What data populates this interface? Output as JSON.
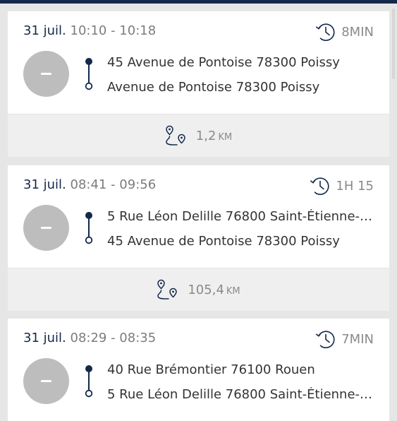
{
  "colors": {
    "header_bar": "#14284a",
    "date_text": "#14284a",
    "muted_text": "#7c7c7c",
    "status_circle": "#bdbdbd"
  },
  "trips": [
    {
      "date": "31 juil.",
      "time_range": "10:10 - 10:18",
      "duration": "8MIN",
      "status_icon": "dash-icon",
      "from": "45 Avenue de Pontoise 78300 Poissy",
      "to": "Avenue de Pontoise 78300 Poissy",
      "distance_value": "1,2",
      "distance_unit": "KM"
    },
    {
      "date": "31 juil.",
      "time_range": "08:41 - 09:56",
      "duration": "1H 15",
      "status_icon": "dash-icon",
      "from": "5 Rue Léon Delille 76800 Saint-Étienne-du...",
      "to": "45 Avenue de Pontoise 78300 Poissy",
      "distance_value": "105,4",
      "distance_unit": "KM"
    },
    {
      "date": "31 juil.",
      "time_range": "08:29 - 08:35",
      "duration": "7MIN",
      "status_icon": "dash-icon",
      "from": "40 Rue Brémontier 76100 Rouen",
      "to": "5 Rue Léon Delille 76800 Saint-Étienne-du...",
      "distance_value": "",
      "distance_unit": ""
    }
  ]
}
